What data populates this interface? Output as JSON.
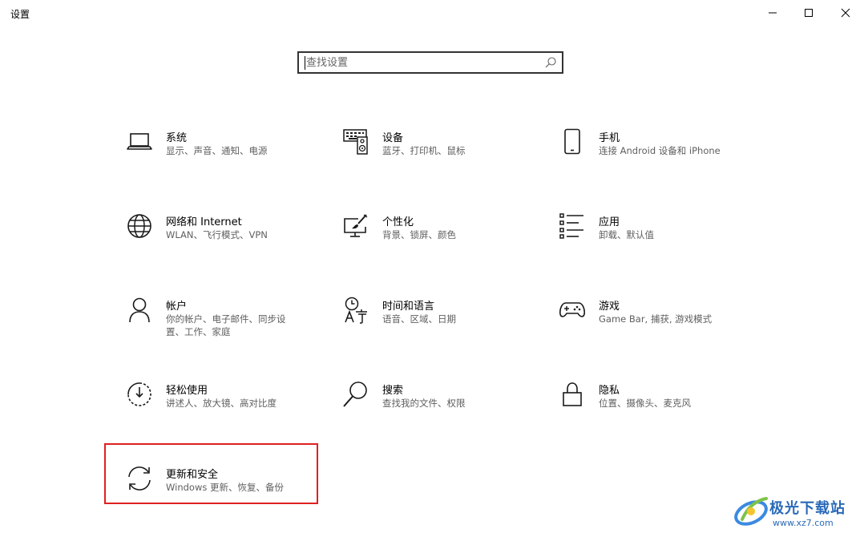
{
  "window": {
    "title": "设置",
    "controls": [
      "minimize-icon",
      "maximize-icon",
      "close-icon"
    ]
  },
  "search": {
    "placeholder": "查找设置",
    "icon": "search-icon"
  },
  "tiles": [
    {
      "id": "system",
      "name": "系统",
      "desc": "显示、声音、通知、电源",
      "icon": "laptop-icon"
    },
    {
      "id": "devices",
      "name": "设备",
      "desc": "蓝牙、打印机、鼠标",
      "icon": "keyboard-speaker-icon"
    },
    {
      "id": "phone",
      "name": "手机",
      "desc": "连接 Android 设备和 iPhone",
      "icon": "phone-icon"
    },
    {
      "id": "network",
      "name": "网络和 Internet",
      "desc": "WLAN、飞行模式、VPN",
      "icon": "globe-icon"
    },
    {
      "id": "personalization",
      "name": "个性化",
      "desc": "背景、锁屏、颜色",
      "icon": "paint-monitor-icon"
    },
    {
      "id": "apps",
      "name": "应用",
      "desc": "卸载、默认值",
      "icon": "app-list-icon"
    },
    {
      "id": "accounts",
      "name": "帐户",
      "desc": "你的帐户、电子邮件、同步设置、工作、家庭",
      "icon": "person-icon"
    },
    {
      "id": "time-language",
      "name": "时间和语言",
      "desc": "语音、区域、日期",
      "icon": "time-language-icon"
    },
    {
      "id": "gaming",
      "name": "游戏",
      "desc": "Game Bar, 捕获, 游戏模式",
      "icon": "gamepad-icon"
    },
    {
      "id": "ease-of-access",
      "name": "轻松使用",
      "desc": "讲述人、放大镜、高对比度",
      "icon": "ease-of-access-icon"
    },
    {
      "id": "search",
      "name": "搜索",
      "desc": "查找我的文件、权限",
      "icon": "magnifier-icon"
    },
    {
      "id": "privacy",
      "name": "隐私",
      "desc": "位置、摄像头、麦克风",
      "icon": "lock-icon"
    },
    {
      "id": "update-security",
      "name": "更新和安全",
      "desc": "Windows 更新、恢复、备份",
      "icon": "sync-icon"
    }
  ],
  "annotation": {
    "highlight_color": "#e02020"
  },
  "watermark": {
    "text": "极光下载站",
    "url": "www.xz7.com",
    "color": "#2a6ab8"
  }
}
